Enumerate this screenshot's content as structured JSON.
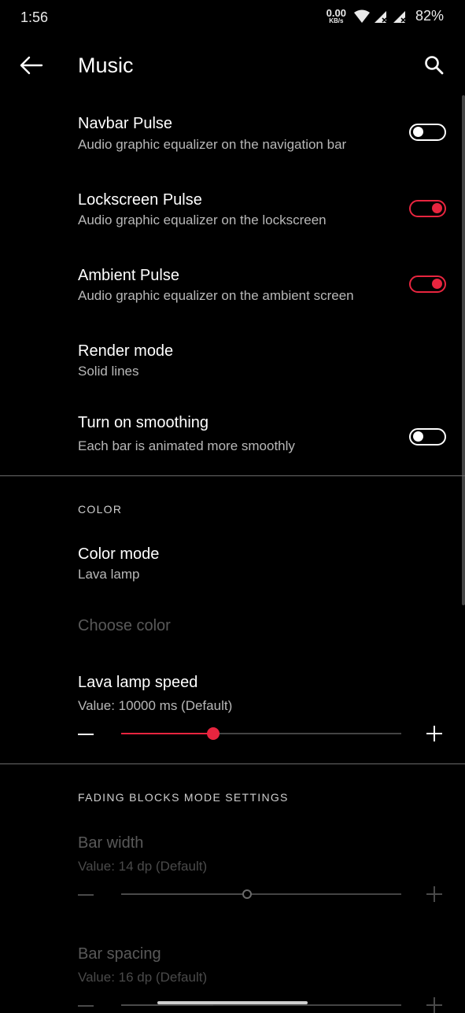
{
  "status_bar": {
    "time": "1:56",
    "net_speed_value": "0.00",
    "net_speed_unit": "KB/s",
    "battery": "82%"
  },
  "app_bar": {
    "title": "Music"
  },
  "items": {
    "navbar_pulse": {
      "title": "Navbar Pulse",
      "subtitle": "Audio graphic equalizer on the navigation bar",
      "enabled": false
    },
    "lockscreen_pulse": {
      "title": "Lockscreen Pulse",
      "subtitle": "Audio graphic equalizer on the lockscreen",
      "enabled": true
    },
    "ambient_pulse": {
      "title": "Ambient Pulse",
      "subtitle": "Audio graphic equalizer on the ambient screen",
      "enabled": true
    },
    "render_mode": {
      "title": "Render mode",
      "subtitle": "Solid lines"
    },
    "smoothing": {
      "title": "Turn on smoothing",
      "subtitle": "Each bar is animated more smoothly",
      "enabled": false
    }
  },
  "color_section": {
    "header": "COLOR",
    "color_mode": {
      "title": "Color mode",
      "subtitle": "Lava lamp"
    },
    "choose_color": {
      "title": "Choose color"
    },
    "lava_lamp_speed": {
      "title": "Lava lamp speed",
      "subtitle": "Value: 10000 ms (Default)",
      "level": 0.33
    }
  },
  "fading_section": {
    "header": "FADING BLOCKS MODE SETTINGS",
    "bar_width": {
      "title": "Bar width",
      "subtitle": "Value: 14 dp (Default)",
      "level": 0.45
    },
    "bar_spacing": {
      "title": "Bar spacing",
      "subtitle": "Value: 16 dp (Default)",
      "level": 0.33
    }
  },
  "colors": {
    "accent": "#e8253f",
    "background": "#000000",
    "secondary_text": "#b8b8b8"
  }
}
